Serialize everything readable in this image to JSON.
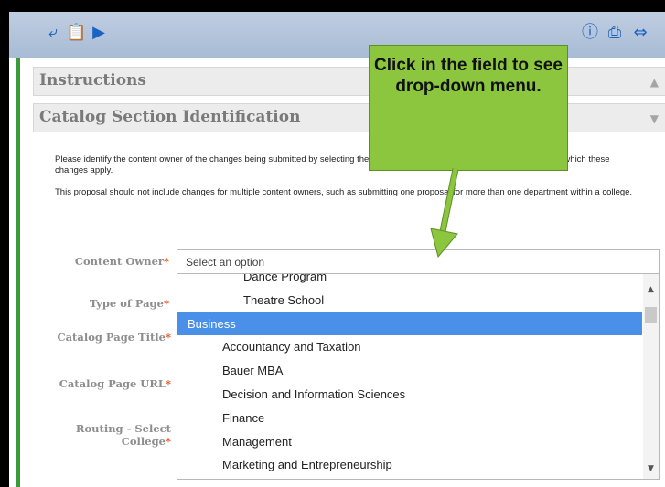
{
  "toolbar": {
    "left_icons": [
      "arrow-down-right-icon",
      "clipboard-icon",
      "play-icon"
    ],
    "right_icons": [
      "info-icon",
      "print-icon",
      "expand-horizontal-icon"
    ]
  },
  "sections": {
    "instructions": "Instructions",
    "catalog": "Catalog Section Identification"
  },
  "intro": {
    "p1": "Please identify the content owner of the changes being submitted by selecting the specific college, department, program, or office to which these changes apply.",
    "p2": "This proposal should not include changes for multiple content owners, such as submitting one proposal for more than one department within a college."
  },
  "fields": {
    "content_owner": "Content Owner",
    "type_of_page": "Type of Page",
    "catalog_page_title": "Catalog Page Title",
    "catalog_page_url": "Catalog Page URL",
    "routing_select_college": "Routing - Select College",
    "required_marker": "*"
  },
  "select": {
    "placeholder": "Select an option"
  },
  "dropdown": {
    "options": [
      {
        "label": "Dance Program",
        "level": 3
      },
      {
        "label": "Theatre School",
        "level": 3
      },
      {
        "label": "Business",
        "level": 1,
        "highlighted": true
      },
      {
        "label": "Accountancy and Taxation",
        "level": 2
      },
      {
        "label": "Bauer MBA",
        "level": 2
      },
      {
        "label": "Decision and Information Sciences",
        "level": 2
      },
      {
        "label": "Finance",
        "level": 2
      },
      {
        "label": "Management",
        "level": 2
      },
      {
        "label": "Marketing and Entrepreneurship",
        "level": 2
      }
    ]
  },
  "callout": {
    "text": "Click in the field to see drop-down menu."
  },
  "colors": {
    "highlight": "#4a90e8",
    "callout": "#8cc63e",
    "required": "#e45a2a"
  }
}
